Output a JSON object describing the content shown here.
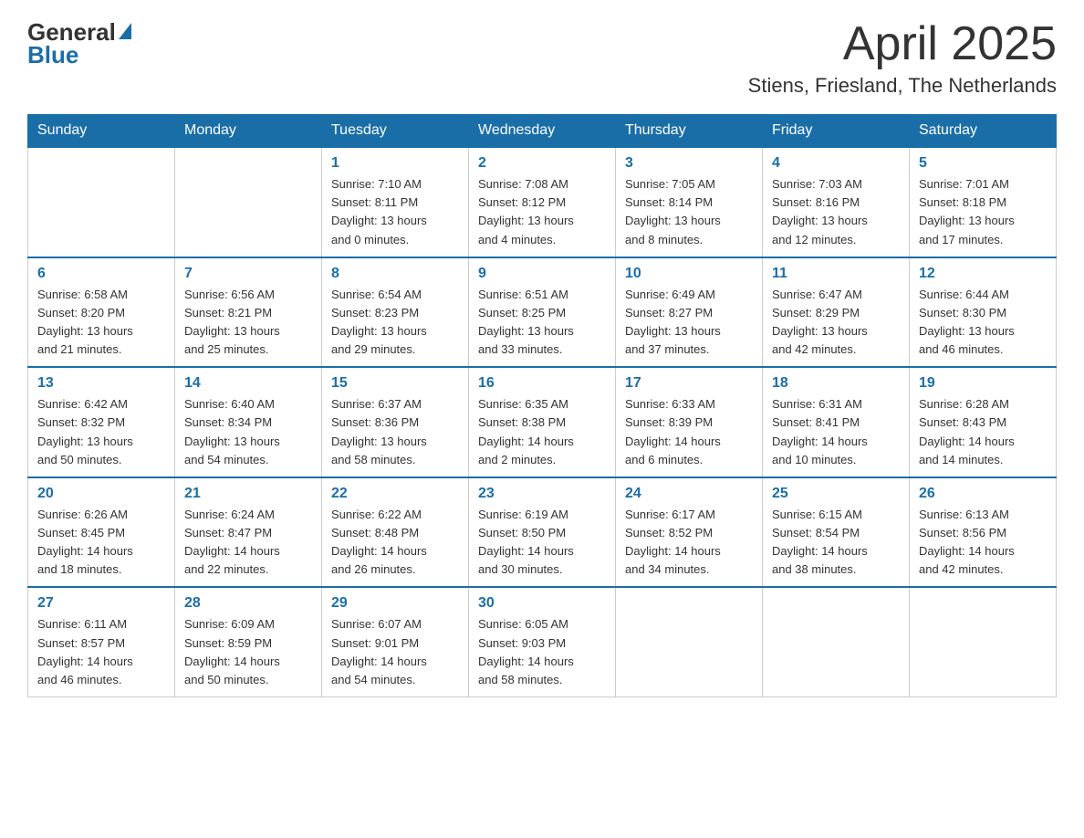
{
  "logo": {
    "general": "General",
    "blue": "Blue"
  },
  "title": "April 2025",
  "subtitle": "Stiens, Friesland, The Netherlands",
  "days_of_week": [
    "Sunday",
    "Monday",
    "Tuesday",
    "Wednesday",
    "Thursday",
    "Friday",
    "Saturday"
  ],
  "weeks": [
    [
      {
        "num": "",
        "info": ""
      },
      {
        "num": "",
        "info": ""
      },
      {
        "num": "1",
        "info": "Sunrise: 7:10 AM\nSunset: 8:11 PM\nDaylight: 13 hours\nand 0 minutes."
      },
      {
        "num": "2",
        "info": "Sunrise: 7:08 AM\nSunset: 8:12 PM\nDaylight: 13 hours\nand 4 minutes."
      },
      {
        "num": "3",
        "info": "Sunrise: 7:05 AM\nSunset: 8:14 PM\nDaylight: 13 hours\nand 8 minutes."
      },
      {
        "num": "4",
        "info": "Sunrise: 7:03 AM\nSunset: 8:16 PM\nDaylight: 13 hours\nand 12 minutes."
      },
      {
        "num": "5",
        "info": "Sunrise: 7:01 AM\nSunset: 8:18 PM\nDaylight: 13 hours\nand 17 minutes."
      }
    ],
    [
      {
        "num": "6",
        "info": "Sunrise: 6:58 AM\nSunset: 8:20 PM\nDaylight: 13 hours\nand 21 minutes."
      },
      {
        "num": "7",
        "info": "Sunrise: 6:56 AM\nSunset: 8:21 PM\nDaylight: 13 hours\nand 25 minutes."
      },
      {
        "num": "8",
        "info": "Sunrise: 6:54 AM\nSunset: 8:23 PM\nDaylight: 13 hours\nand 29 minutes."
      },
      {
        "num": "9",
        "info": "Sunrise: 6:51 AM\nSunset: 8:25 PM\nDaylight: 13 hours\nand 33 minutes."
      },
      {
        "num": "10",
        "info": "Sunrise: 6:49 AM\nSunset: 8:27 PM\nDaylight: 13 hours\nand 37 minutes."
      },
      {
        "num": "11",
        "info": "Sunrise: 6:47 AM\nSunset: 8:29 PM\nDaylight: 13 hours\nand 42 minutes."
      },
      {
        "num": "12",
        "info": "Sunrise: 6:44 AM\nSunset: 8:30 PM\nDaylight: 13 hours\nand 46 minutes."
      }
    ],
    [
      {
        "num": "13",
        "info": "Sunrise: 6:42 AM\nSunset: 8:32 PM\nDaylight: 13 hours\nand 50 minutes."
      },
      {
        "num": "14",
        "info": "Sunrise: 6:40 AM\nSunset: 8:34 PM\nDaylight: 13 hours\nand 54 minutes."
      },
      {
        "num": "15",
        "info": "Sunrise: 6:37 AM\nSunset: 8:36 PM\nDaylight: 13 hours\nand 58 minutes."
      },
      {
        "num": "16",
        "info": "Sunrise: 6:35 AM\nSunset: 8:38 PM\nDaylight: 14 hours\nand 2 minutes."
      },
      {
        "num": "17",
        "info": "Sunrise: 6:33 AM\nSunset: 8:39 PM\nDaylight: 14 hours\nand 6 minutes."
      },
      {
        "num": "18",
        "info": "Sunrise: 6:31 AM\nSunset: 8:41 PM\nDaylight: 14 hours\nand 10 minutes."
      },
      {
        "num": "19",
        "info": "Sunrise: 6:28 AM\nSunset: 8:43 PM\nDaylight: 14 hours\nand 14 minutes."
      }
    ],
    [
      {
        "num": "20",
        "info": "Sunrise: 6:26 AM\nSunset: 8:45 PM\nDaylight: 14 hours\nand 18 minutes."
      },
      {
        "num": "21",
        "info": "Sunrise: 6:24 AM\nSunset: 8:47 PM\nDaylight: 14 hours\nand 22 minutes."
      },
      {
        "num": "22",
        "info": "Sunrise: 6:22 AM\nSunset: 8:48 PM\nDaylight: 14 hours\nand 26 minutes."
      },
      {
        "num": "23",
        "info": "Sunrise: 6:19 AM\nSunset: 8:50 PM\nDaylight: 14 hours\nand 30 minutes."
      },
      {
        "num": "24",
        "info": "Sunrise: 6:17 AM\nSunset: 8:52 PM\nDaylight: 14 hours\nand 34 minutes."
      },
      {
        "num": "25",
        "info": "Sunrise: 6:15 AM\nSunset: 8:54 PM\nDaylight: 14 hours\nand 38 minutes."
      },
      {
        "num": "26",
        "info": "Sunrise: 6:13 AM\nSunset: 8:56 PM\nDaylight: 14 hours\nand 42 minutes."
      }
    ],
    [
      {
        "num": "27",
        "info": "Sunrise: 6:11 AM\nSunset: 8:57 PM\nDaylight: 14 hours\nand 46 minutes."
      },
      {
        "num": "28",
        "info": "Sunrise: 6:09 AM\nSunset: 8:59 PM\nDaylight: 14 hours\nand 50 minutes."
      },
      {
        "num": "29",
        "info": "Sunrise: 6:07 AM\nSunset: 9:01 PM\nDaylight: 14 hours\nand 54 minutes."
      },
      {
        "num": "30",
        "info": "Sunrise: 6:05 AM\nSunset: 9:03 PM\nDaylight: 14 hours\nand 58 minutes."
      },
      {
        "num": "",
        "info": ""
      },
      {
        "num": "",
        "info": ""
      },
      {
        "num": "",
        "info": ""
      }
    ]
  ]
}
